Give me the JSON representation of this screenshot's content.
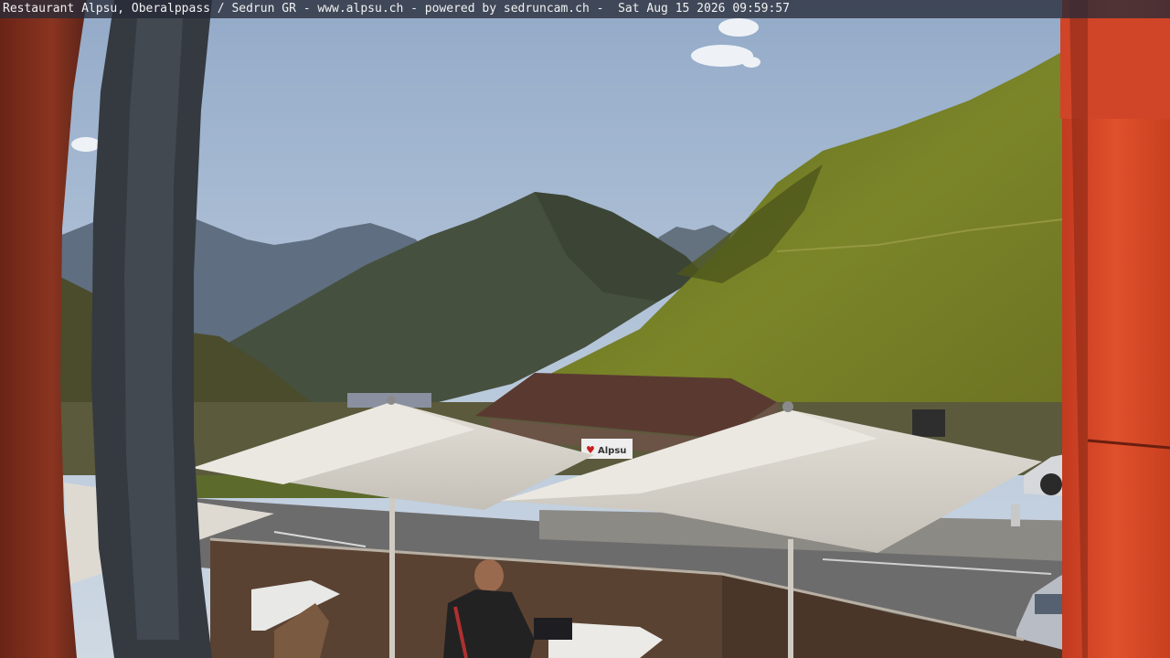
{
  "webcam": {
    "caption": "Restaurant Alpsu, Oberalppass / Sedrun GR - www.alpsu.ch - powered by sedruncam.ch -  Sat Aug 15 2026 09:59:57",
    "sign_text": "Alpsu",
    "sign_heart": "♥"
  },
  "colors": {
    "sky_top": "#9fb4cf",
    "sky_bottom": "#c9d6e4",
    "far_mountains": "#5c6a7a",
    "mid_mountain": "#3f4a3c",
    "green_slope": "#6f7a26",
    "frame_red": "#d8482a",
    "frame_dark": "#3b2216",
    "umbrella": "#d8d4cc",
    "road": "#6b6a6a"
  }
}
